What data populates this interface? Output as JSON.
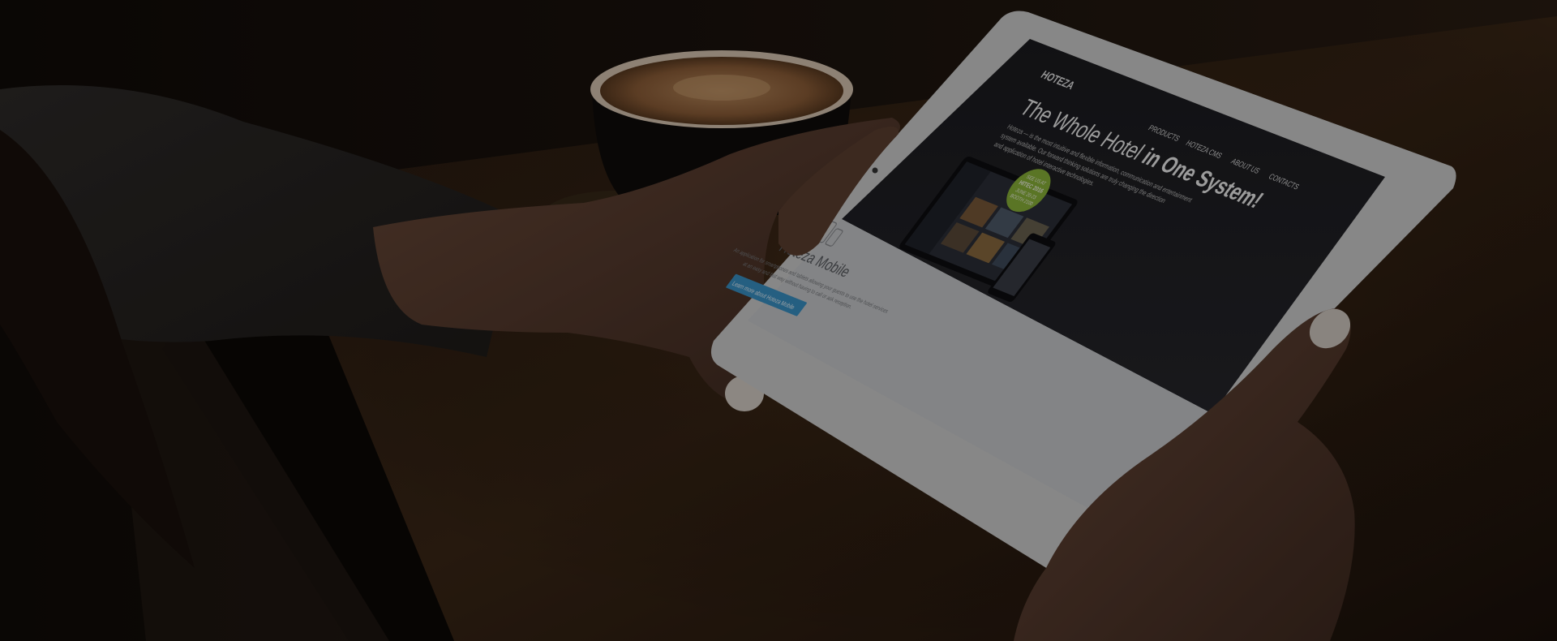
{
  "site": {
    "logo_text": "HOTEZA",
    "nav": [
      "PRODUCTS",
      "HOTEZA CMS",
      "ABOUT US",
      "CONTACTS"
    ],
    "headline_regular": "The Whole Hotel ",
    "headline_bold": "in One System!",
    "intro_lines": [
      "Hoteza — is the most intuitive and flexible information, communication and entertainment",
      "system available. Our forward thinking solutions are truly changing the direction",
      "and application of hotel interactive technologies."
    ],
    "badge_lines": [
      "SEE US AT",
      "HITEC 2016",
      "JUNE 20-23",
      "BOOTH 2100"
    ],
    "section_title": "Hoteza Mobile",
    "section_desc_lines": [
      "An application for smartphones and tablets allowing your guests to use the hotel services",
      "at an easy and fast way without having to call or ask reception."
    ],
    "cta_label": "Learn more about Hoteza Mobile"
  },
  "colors": {
    "badge": "#8bb43a",
    "cta": "#3a93c7",
    "screen_dark": "#18181b",
    "screen_light": "#c9cbce",
    "tablet_frame": "#cfcfcf",
    "coffee": "#9a6a45"
  }
}
